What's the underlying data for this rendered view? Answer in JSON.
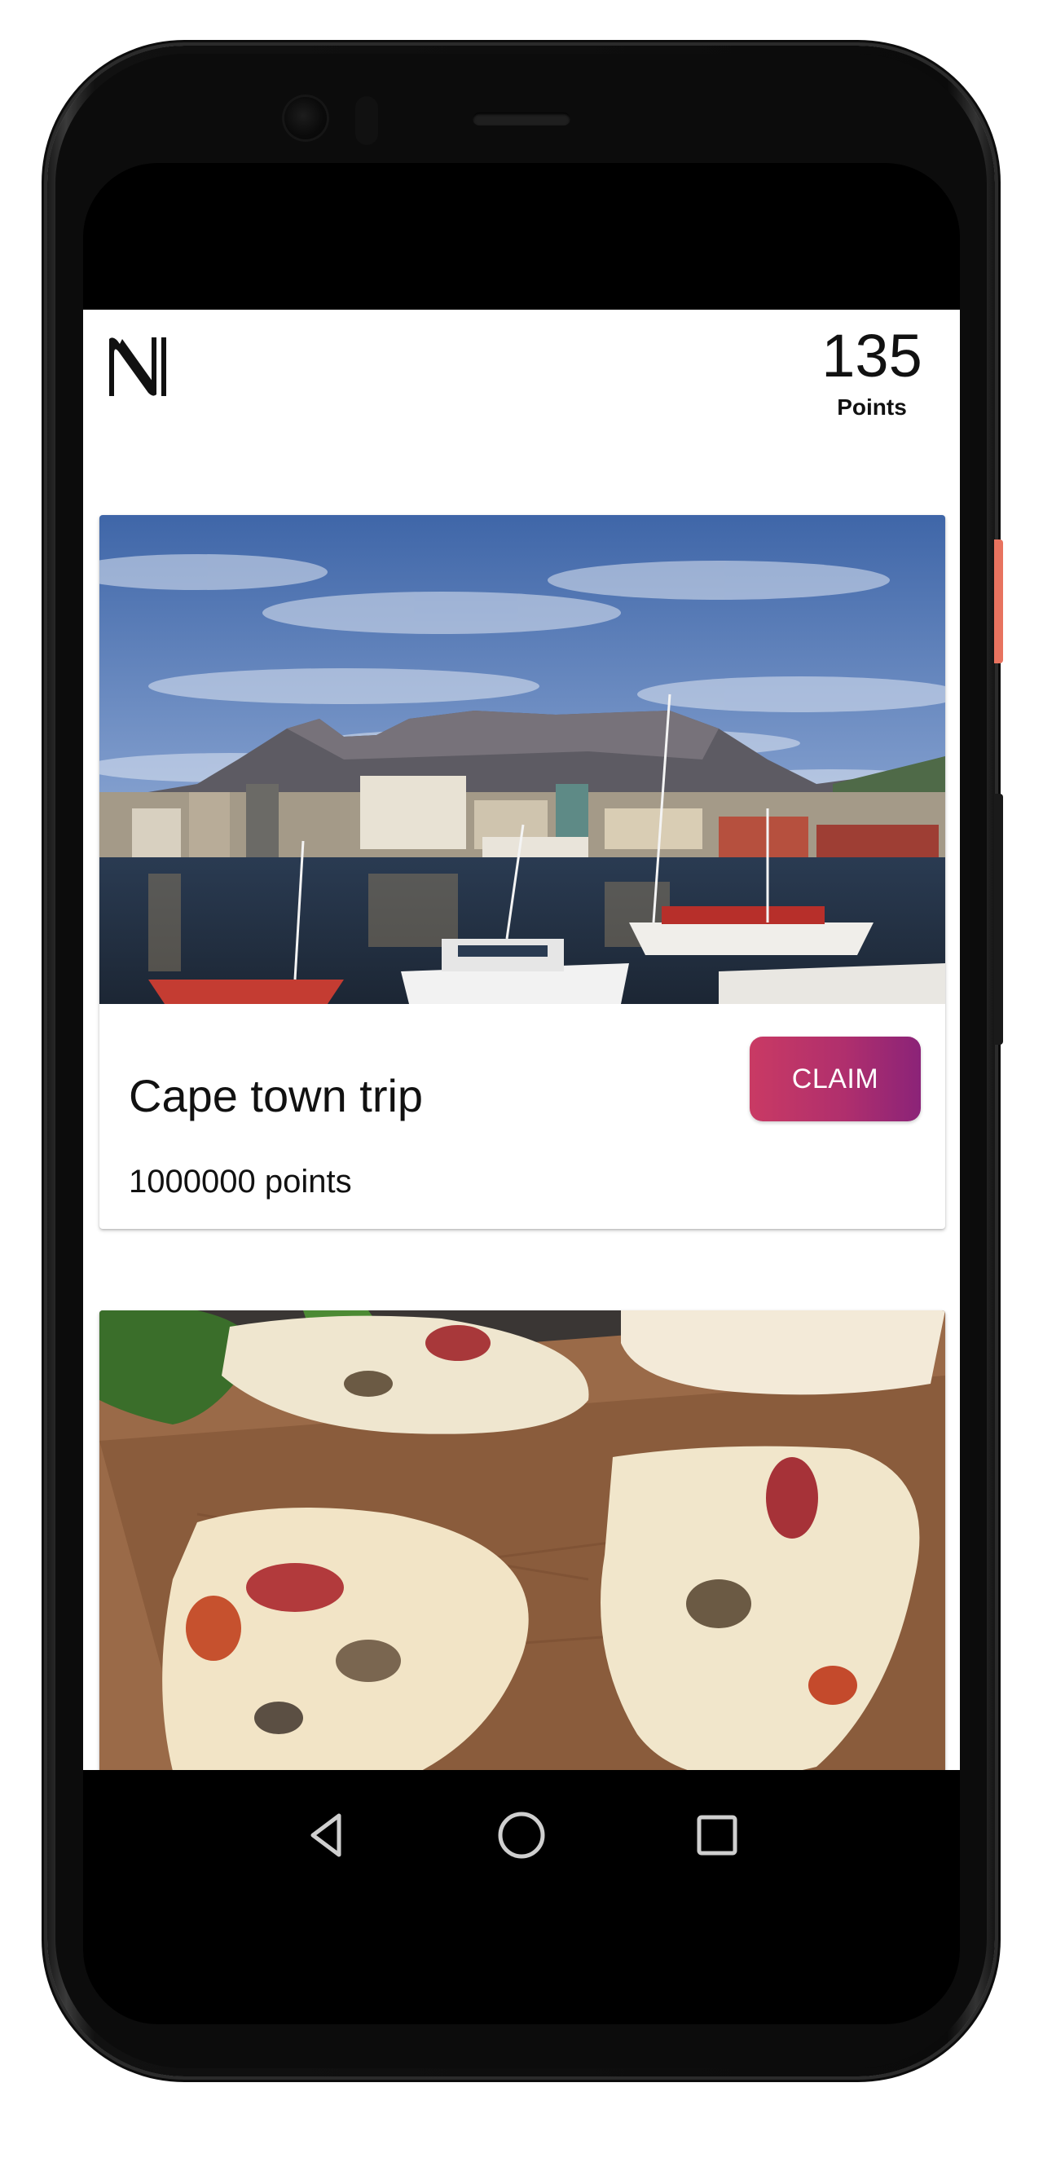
{
  "header": {
    "logo_letter": "N",
    "points_value": "135",
    "points_label": "Points"
  },
  "rewards": [
    {
      "title": "Cape town trip",
      "points": "1000000 points",
      "claim_label": "CLAIM",
      "image": "cape-town-harbor-photo"
    },
    {
      "image": "food-flatbread-photo"
    }
  ],
  "navigation": {
    "back_icon": "back-triangle-icon",
    "home_icon": "home-circle-icon",
    "recents_icon": "recents-square-icon"
  },
  "colors": {
    "claim_gradient_start": "#c93a64",
    "claim_gradient_end": "#8b2378",
    "accent_side_button": "#e8735f"
  }
}
